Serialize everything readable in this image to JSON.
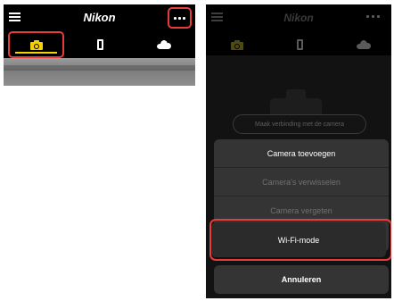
{
  "left_screen": {
    "app_title": "Nikon",
    "icons": {
      "menu": "hamburger-icon",
      "more": "more-options-icon",
      "camera_tab": "camera-icon",
      "phone_tab": "smartphone-icon",
      "cloud_tab": "cloud-icon"
    },
    "colors": {
      "accent": "#f4d200",
      "highlight_border": "#e53c3c"
    }
  },
  "right_screen": {
    "app_title": "Nikon",
    "connect_button": "Maak verbinding met de camera",
    "menu_items": [
      {
        "label": "Camera toevoegen",
        "enabled": true
      },
      {
        "label": "Camera's verwisselen",
        "enabled": false
      },
      {
        "label": "Camera vergeten",
        "enabled": false
      },
      {
        "label": "Wi-Fi-mode",
        "enabled": true
      }
    ],
    "cancel_label": "Annuleren"
  }
}
